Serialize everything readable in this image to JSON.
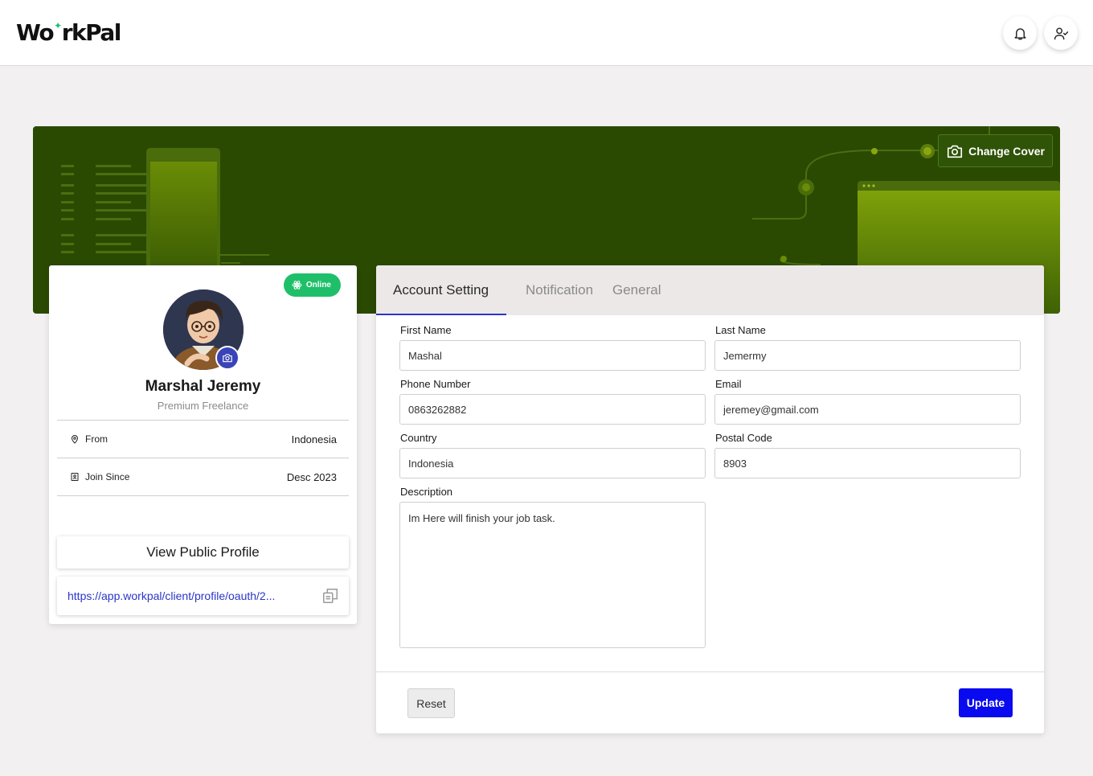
{
  "header": {
    "logo_part1": "Wo",
    "logo_spark": "✦",
    "logo_part2": "rkPal",
    "icons": [
      "bell-icon",
      "user-check-icon"
    ]
  },
  "cover": {
    "change_cover_label": "Change Cover",
    "background_color": "#2a4a02",
    "accent_color": "#7ea10a"
  },
  "profile": {
    "status": "Online",
    "name": "Marshal Jeremy",
    "role": "Premium Freelance",
    "from_label": "From",
    "from_value": "Indonesia",
    "join_label": "Join Since",
    "join_value": "Desc 2023",
    "view_public_label": "View Public Profile",
    "public_url": "https://app.workpal/client/profile/oauth/2...",
    "status_color": "#1fbf6a"
  },
  "settings": {
    "tabs": [
      {
        "label": "Account Setting",
        "active": true
      },
      {
        "label": "Notification",
        "active": false
      },
      {
        "label": "General",
        "active": false
      }
    ],
    "fields": {
      "first_name": {
        "label": "First Name",
        "value": "Mashal"
      },
      "last_name": {
        "label": "Last Name",
        "value": "Jemermy"
      },
      "phone": {
        "label": "Phone Number",
        "value": "0863262882"
      },
      "email": {
        "label": "Email",
        "value": "jeremey@gmail.com"
      },
      "country": {
        "label": "Country",
        "value": "Indonesia"
      },
      "postal_code": {
        "label": "Postal Code",
        "value": "8903"
      },
      "description": {
        "label": "Description",
        "value": "Im Here will finish your job task."
      }
    },
    "reset_label": "Reset",
    "update_label": "Update",
    "primary_color": "#0a0af0"
  }
}
